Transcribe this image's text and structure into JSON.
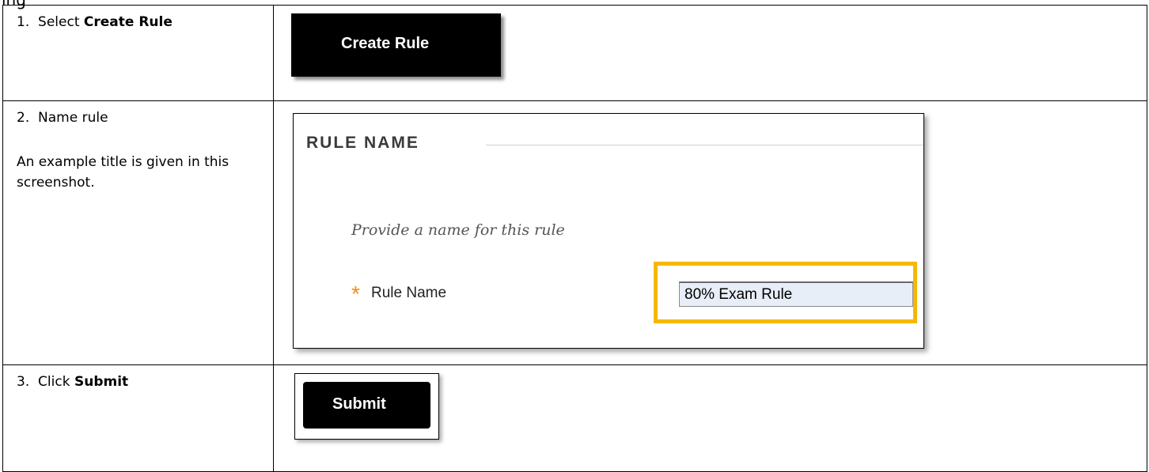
{
  "top_clip": "ing",
  "steps": [
    {
      "number": "1.",
      "prefix": "Select ",
      "bold": "Create Rule"
    },
    {
      "number": "2.",
      "text": "Name rule",
      "note": "An example title is given in this screenshot."
    },
    {
      "number": "3.",
      "prefix": "Click ",
      "bold": "Submit"
    }
  ],
  "create_button": {
    "label": "Create Rule"
  },
  "rule_panel": {
    "title": "RULE NAME",
    "instruction": "Provide a name for this rule",
    "required_marker": "*",
    "field_label": "Rule Name",
    "field_value": "80% Exam Rule",
    "highlight_color": "#f5b800"
  },
  "submit_button": {
    "label": "Submit"
  }
}
